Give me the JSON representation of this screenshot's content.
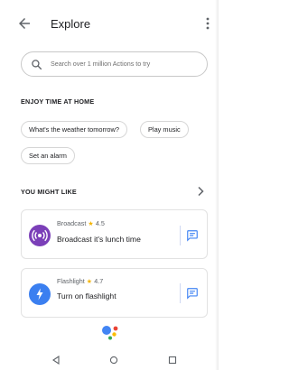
{
  "header": {
    "title": "Explore",
    "back_icon": "arrow-back-icon",
    "more_icon": "more-vert-icon"
  },
  "search": {
    "placeholder": "Search over 1 million Actions to try",
    "icon": "search-icon"
  },
  "sections": {
    "enjoy": {
      "title": "ENJOY TIME AT HOME",
      "chips": [
        "What's the weather tomorrow?",
        "Play music",
        "Set an alarm"
      ]
    },
    "might_like": {
      "title": "YOU MIGHT LIKE",
      "cards": [
        {
          "app": "Broadcast",
          "rating": "4.5",
          "action": "Broadcast it's lunch time",
          "icon": "broadcast-icon",
          "icon_color": "#7b3fb8"
        },
        {
          "app": "Flashlight",
          "rating": "4.7",
          "action": "Turn on flashlight",
          "icon": "flashlight-icon",
          "icon_color": "#3b7ff0"
        }
      ]
    }
  },
  "colors": {
    "star": "#f4b400",
    "feedback": "#4285f4",
    "assistant_blue": "#4285f4",
    "assistant_red": "#ea4335",
    "assistant_yellow": "#fbbc05",
    "assistant_green": "#34a853"
  }
}
